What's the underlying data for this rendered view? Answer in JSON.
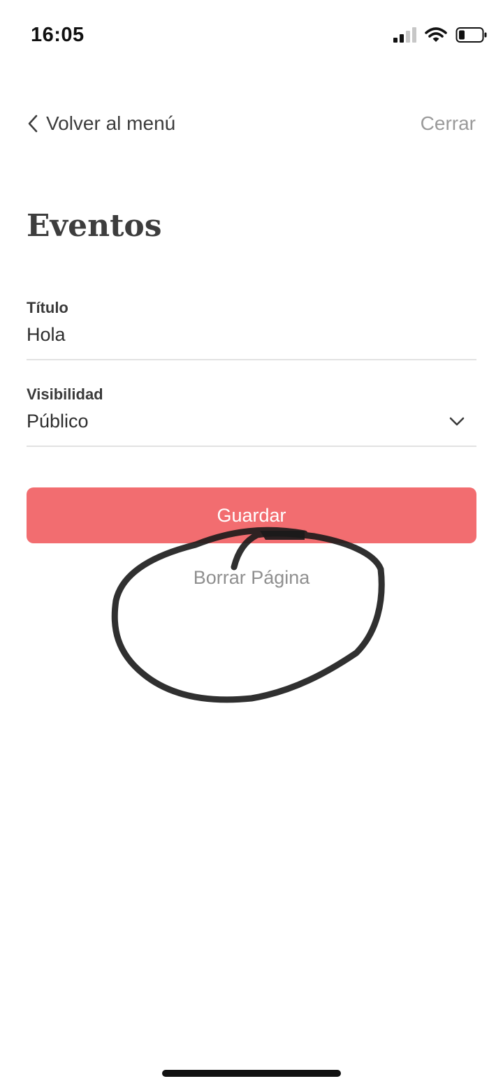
{
  "status_bar": {
    "time": "16:05",
    "icons": [
      "signal-icon",
      "wifi-icon",
      "battery-icon"
    ]
  },
  "nav": {
    "back_label": "Volver al menú",
    "close_label": "Cerrar"
  },
  "page": {
    "title": "Eventos"
  },
  "form": {
    "title_field": {
      "label": "Título",
      "value": "Hola"
    },
    "visibility_field": {
      "label": "Visibilidad",
      "value": "Público"
    }
  },
  "actions": {
    "save_label": "Guardar",
    "delete_label": "Borrar Página"
  },
  "colors": {
    "accent": "#f26d70",
    "annotation": "#1a1a1a"
  }
}
